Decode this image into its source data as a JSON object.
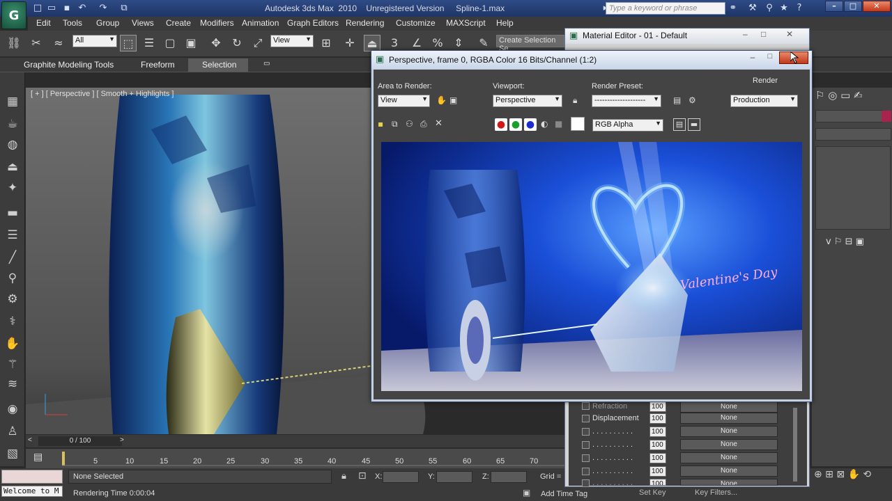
{
  "app": {
    "logo": "G",
    "title": "Autodesk 3ds Max  2010    Unregistered Version     Spline-1.max",
    "search_placeholder": "Type a keyword or phrase"
  },
  "menu": [
    "Edit",
    "Tools",
    "Group",
    "Views",
    "Create",
    "Modifiers",
    "Animation",
    "Graph Editors",
    "Rendering",
    "Customize",
    "MAXScript",
    "Help"
  ],
  "toolbar": {
    "selection_filter": "All",
    "reference_coord": "View",
    "snap_count": "3",
    "named_selection_set": "Create Selection Se"
  },
  "ribbon": {
    "tabs": [
      "Graphite Modeling Tools",
      "Freeform",
      "Selection"
    ],
    "active": "Selection"
  },
  "viewport": {
    "label": "[ + ] [ Perspective ] [ Smooth + Highlights ]"
  },
  "timeline": {
    "counter": "0 / 100",
    "ticks": [
      "5",
      "10",
      "15",
      "20",
      "25",
      "30",
      "35",
      "40",
      "45",
      "50",
      "55",
      "60",
      "65",
      "70"
    ]
  },
  "status": {
    "maxscript_text": "Welcome to M",
    "selection": "None Selected",
    "rendering_time": "Rendering Time  0:00:04",
    "x_label": "X:",
    "y_label": "Y:",
    "z_label": "Z:",
    "grid": "Grid =",
    "add_time_tag": "Add Time Tag",
    "set_key": "Set Key",
    "key_filters": "Key Filters..."
  },
  "material_editor": {
    "title": "Material Editor - 01 - Default",
    "rows": [
      {
        "label": "Refraction",
        "value": "100",
        "map": "None"
      },
      {
        "label": "Displacement",
        "value": "100",
        "map": "None"
      },
      {
        "label": ". . . . . . . . . .",
        "value": "100",
        "map": "None"
      },
      {
        "label": ". . . . . . . . . .",
        "value": "100",
        "map": "None"
      },
      {
        "label": ". . . . . . . . . .",
        "value": "100",
        "map": "None"
      },
      {
        "label": ". . . . . . . . . .",
        "value": "100",
        "map": "None"
      },
      {
        "label": ". . . . . . . . . .",
        "value": "100",
        "map": "None"
      }
    ]
  },
  "render_window": {
    "title": "Perspective, frame 0, RGBA Color 16 Bits/Channel (1:2)",
    "area_label": "Area to Render:",
    "area_value": "View",
    "viewport_label": "Viewport:",
    "viewport_value": "Perspective",
    "preset_label": "Render Preset:",
    "preset_value": "--------------------",
    "render_button": "Render",
    "render_mode": "Production",
    "channel_value": "RGB Alpha",
    "image_caption": "Valentine's Day"
  }
}
